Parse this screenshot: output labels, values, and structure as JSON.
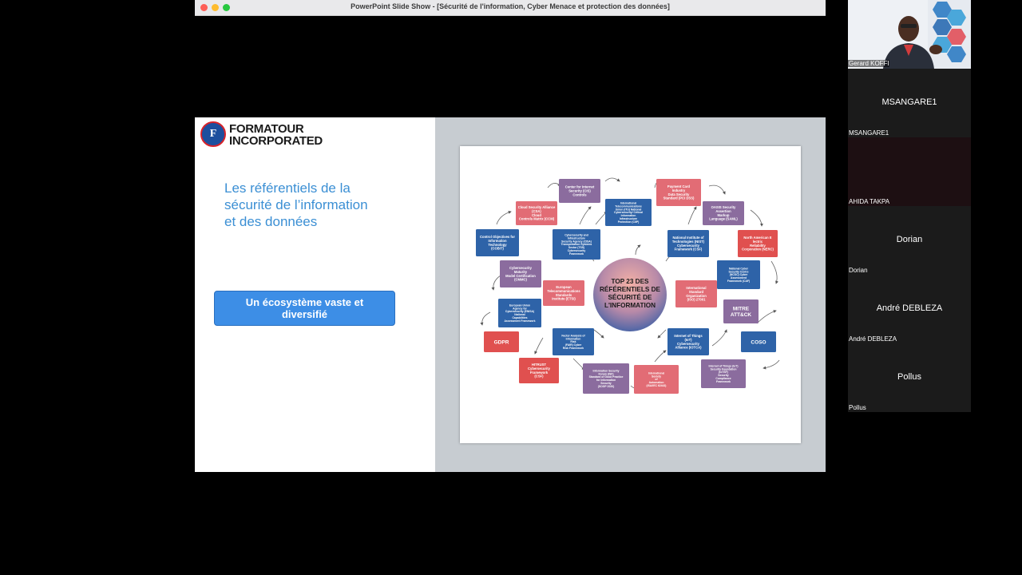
{
  "window": {
    "title": "PowerPoint Slide Show - [Sécurité de l'information, Cyber Menace et protection des données]"
  },
  "slide": {
    "logo_initials": "F",
    "logo_line1": "FORMATOUR",
    "logo_line2": "INCORPORATED",
    "heading_line1": "Les référentiels de la",
    "heading_line2": "sécurité de l’information",
    "heading_line3": "et des données",
    "callout_line1": "Un écosystème vaste et",
    "callout_line2": "diversifié",
    "diagram": {
      "center_lines": [
        "TOP 23 DES",
        "RÉFÉRENTIELS DE",
        "SÉCURITÉ DE",
        "L'INFORMATION"
      ],
      "colors": {
        "blue": "#2e63a8",
        "pink": "#e26c75",
        "purple": "#8b6c9e",
        "red": "#e0504f"
      },
      "nodes": [
        {
          "color": "purple",
          "lines": [
            "Center for Internet",
            "Security (CIS)",
            "Controls"
          ]
        },
        {
          "color": "pink",
          "lines": [
            "Cloud Security Alliance",
            "(CSA)",
            "Cloud",
            "Controls Matrix (CCM)"
          ]
        },
        {
          "color": "blue",
          "lines": [
            "International",
            "Telecommunications",
            "Union (ITU) National",
            "Cybersecurity/ Critical",
            "Information",
            "Infrastructure",
            "Protection (CIIP)"
          ]
        },
        {
          "color": "pink",
          "lines": [
            "Payment Card",
            "Industry",
            "Data Security",
            "Standard (PCI DSS)"
          ]
        },
        {
          "color": "purple",
          "lines": [
            "OASIS Security",
            "Assertion",
            "Markup",
            "Language (SAML)"
          ]
        },
        {
          "color": "blue",
          "lines": [
            "Control Objectives for",
            "Information",
            "Technology",
            "(COBIT)"
          ]
        },
        {
          "color": "blue",
          "lines": [
            "Cybersecurity and",
            "Infrastructure",
            "Security Agency (CISA)",
            "Transportation Systems",
            "Sector (TSS)",
            "Cybersecurity",
            "Framework"
          ]
        },
        {
          "color": "blue",
          "lines": [
            "National Institute of",
            "Technologies (NIST)",
            "Cybersecurity",
            "Framework (CSF)"
          ]
        },
        {
          "color": "red",
          "lines": [
            "North American E",
            "lectric",
            "Reliability",
            "Corporation (NERC)"
          ]
        },
        {
          "color": "purple",
          "lines": [
            "Cybersecurity",
            "Maturity",
            "Model Certification",
            "(CMMC)"
          ]
        },
        {
          "color": "blue",
          "lines": [
            "National Cyber",
            "Security Centre",
            "(NCSC) Cyber",
            "Assessment",
            "Framework (CAF)"
          ]
        },
        {
          "color": "pink",
          "lines": [
            "European",
            "Telecommunications",
            "Standards",
            "Institute (ETSI)"
          ]
        },
        {
          "color": "pink",
          "lines": [
            "International",
            "Standard",
            "Organization",
            "(ISO) 27001"
          ]
        },
        {
          "color": "blue",
          "lines": [
            "European Union",
            "Agency for",
            "Cybersecurity (ENISA)",
            "National",
            "Capabilities",
            "Assessment Framework"
          ]
        },
        {
          "color": "purple",
          "lines": [
            "MITRE",
            "ATT&CK"
          ]
        },
        {
          "color": "red",
          "lines": [
            "GDPR"
          ]
        },
        {
          "color": "blue",
          "lines": [
            "Factor Analysis of",
            "Information",
            "Risk",
            "(FAIR) Cyber",
            "Risk Framework"
          ]
        },
        {
          "color": "blue",
          "lines": [
            "Internet of Things",
            "(IoT)",
            "Cybersecurity",
            "Alliance (IOTCA)"
          ]
        },
        {
          "color": "blue",
          "lines": [
            "COSO"
          ]
        },
        {
          "color": "red",
          "lines": [
            "HITRUST",
            "Cybersecurity",
            "Framework",
            "(CSF)"
          ]
        },
        {
          "color": "purple",
          "lines": [
            "Information Security",
            "Forum (ISF)",
            "Standard of Good Practice",
            "for Information",
            "Security",
            "(SOGP 2020)"
          ]
        },
        {
          "color": "pink",
          "lines": [
            "International",
            "Society",
            "of",
            "Automation",
            "(ISA/IEC 62443)"
          ]
        },
        {
          "color": "purple",
          "lines": [
            "Internet of Things (IoT)",
            "Security Foundation",
            "(IoTSF)",
            "Security",
            "Compliance",
            "Framework"
          ]
        }
      ]
    }
  },
  "participants": [
    {
      "name": "Gerard KOFFI",
      "label": ""
    },
    {
      "name": "MSANGARE1",
      "label": "MSANGARE1"
    },
    {
      "name": "AHIDA TAKPA",
      "label": ""
    },
    {
      "name": "Dorian",
      "label": "Dorian"
    },
    {
      "name": "André DEBLEZA",
      "label": "André DEBLEZA"
    },
    {
      "name": "Pollus",
      "label": "Pollus"
    }
  ]
}
